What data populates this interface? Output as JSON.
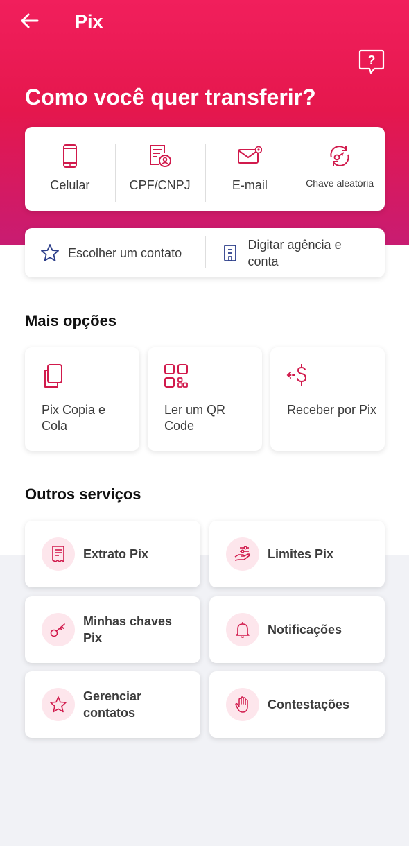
{
  "header": {
    "title": "Pix"
  },
  "hero": {
    "title": "Como você quer transferir?"
  },
  "methods": [
    {
      "label": "Celular",
      "icon": "smartphone-icon"
    },
    {
      "label": "CPF/CNPJ",
      "icon": "id-document-icon"
    },
    {
      "label": "E-mail",
      "icon": "email-icon"
    },
    {
      "label": "Chave aleatória",
      "icon": "random-key-icon"
    }
  ],
  "contact_options": [
    {
      "label": "Escolher um contato",
      "icon": "star-icon"
    },
    {
      "label": "Digitar agência e conta",
      "icon": "bank-building-icon"
    }
  ],
  "more_options": {
    "title": "Mais opções",
    "items": [
      {
        "label": "Pix Copia e Cola",
        "icon": "copy-icon"
      },
      {
        "label": "Ler um QR Code",
        "icon": "qr-code-icon"
      },
      {
        "label": "Receber por Pix",
        "icon": "receive-money-icon"
      }
    ]
  },
  "other_services": {
    "title": "Outros serviços",
    "items": [
      {
        "label": "Extrato Pix",
        "icon": "statement-icon"
      },
      {
        "label": "Limites Pix",
        "icon": "limits-icon"
      },
      {
        "label": "Minhas chaves Pix",
        "icon": "key-icon"
      },
      {
        "label": "Notificações",
        "icon": "bell-icon"
      },
      {
        "label": "Gerenciar contatos",
        "icon": "star-icon"
      },
      {
        "label": "Contestações",
        "icon": "hand-icon"
      }
    ]
  },
  "colors": {
    "brand": "#ec1a57",
    "icon": "#d11a4c",
    "icon_bg": "#fde6ec"
  }
}
